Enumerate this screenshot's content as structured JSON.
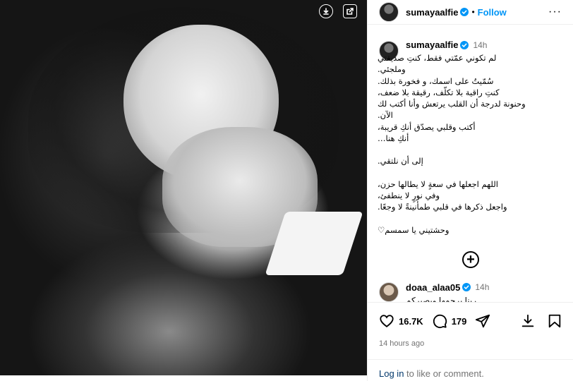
{
  "post": {
    "username": "sumayaalfie",
    "follow_label": "Follow",
    "dot": "•",
    "more": "···",
    "caption_time": "14h",
    "caption_lines": [
      "لم تكوني عمّتي فقط، كنتِ صديقتي",
      "وملجئي.",
      "سُمّيتُ على اسمك، و فخورة بذلك.",
      "كنتِ راقية بلا تكلّف، رقيقة بلا ضعف،",
      "وحنونة لدرجة أن القلب يرتعش وأنا أكتب لك",
      "الآن.",
      "أكتب وقلبي يصدّق أنكِ قريبة،",
      "أنكِ هنا…",
      "",
      "إلى أن نلتقي.",
      "",
      "اللهم اجعلها في سعةٍ لا يطالها حزن،",
      "وفي نورٍ لا ينطفئ،",
      "واجعل ذكرها في قلبي طمأنينةً لا وجعًا.",
      "",
      "وحشتيني يا سمسم♡"
    ],
    "add_more_label": "+",
    "comment": {
      "username": "doaa_alaa05",
      "time": "14h",
      "text": "ربنا يرحمها ويصبركم"
    }
  },
  "actions": {
    "likes": "16.7K",
    "comments": "179",
    "posted": "14 hours ago",
    "login_link": "Log in",
    "login_rest": " to like or comment."
  },
  "colors": {
    "accent": "#0095f6",
    "muted": "#737373",
    "link": "#00376b"
  },
  "icons": [
    "download-icon",
    "external-link-icon",
    "verified-icon",
    "more-icon",
    "heart-icon",
    "comment-icon",
    "share-icon",
    "save-icon",
    "add-circle-icon"
  ]
}
